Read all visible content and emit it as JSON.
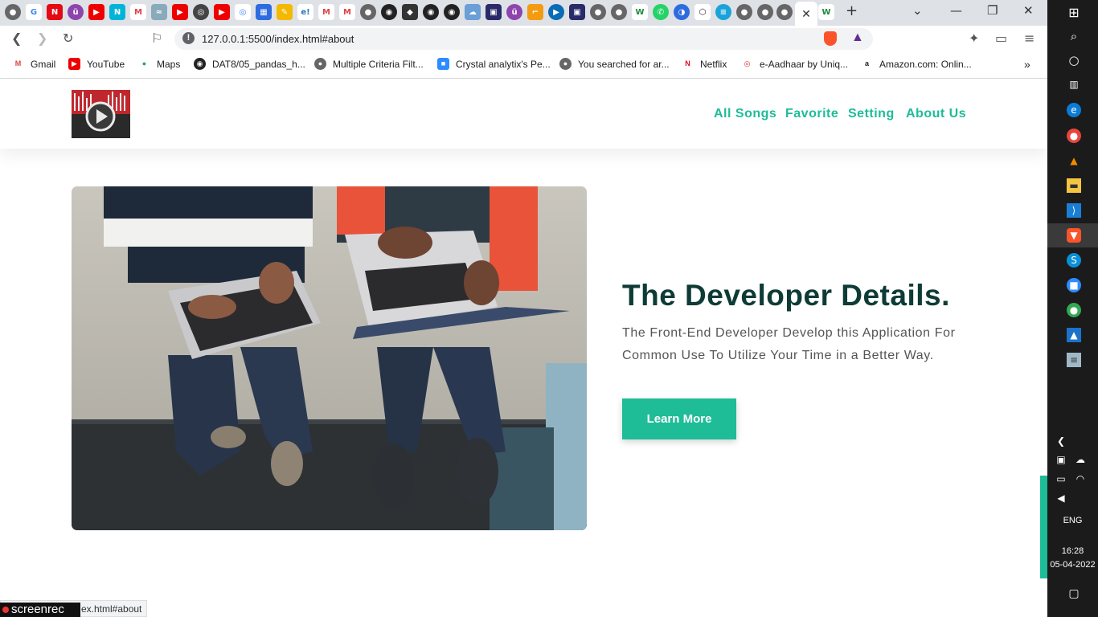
{
  "browser": {
    "url": "127.0.0.1:5500/index.html#about",
    "bookmarks": [
      "Gmail",
      "YouTube",
      "Maps",
      "DAT8/05_pandas_h...",
      "Multiple Criteria Filt...",
      "Crystal analytix's Pe...",
      "You searched for ar...",
      "Netflix",
      "e-Aadhaar by Uniq...",
      "Amazon.com: Onlin..."
    ],
    "status_text": "ex.html#about"
  },
  "site": {
    "nav": [
      "All Songs",
      "Favorite",
      "Setting",
      "About Us"
    ],
    "title": "The Developer Details.",
    "description": "The Front-End Developer Develop this Application For Common Use To Utilize Your Time in a Better Way.",
    "button": "Learn More",
    "accent_color": "#1ebc97",
    "title_color": "#0e3b36"
  },
  "overlay": {
    "recorder_label": "screenrec"
  },
  "taskbar": {
    "language": "ENG",
    "time": "16:28",
    "date": "05-04-2022"
  }
}
